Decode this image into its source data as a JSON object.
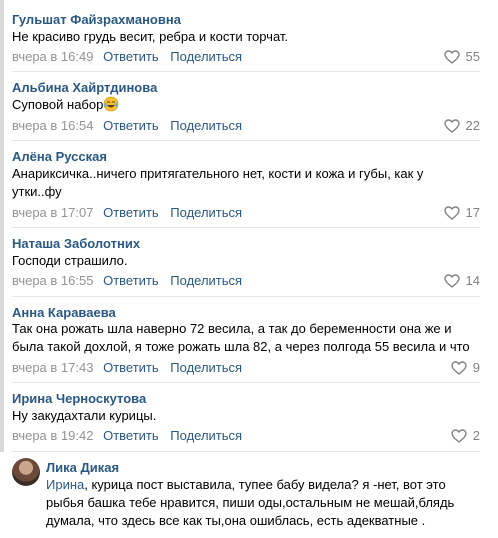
{
  "comments": [
    {
      "author": "Гульшат Файзрахмановна",
      "text": "Не красиво грудь весит, ребра и кости торчат.",
      "time": "вчера в 16:49",
      "reply": "Ответить",
      "share": "Поделиться",
      "likes": "55"
    },
    {
      "author": "Альбина Хайртдинова",
      "text": "Суповой набор",
      "emoji": "laughing-tears-icon",
      "time": "вчера в 16:54",
      "reply": "Ответить",
      "share": "Поделиться",
      "likes": "22"
    },
    {
      "author": "Алёна Русская",
      "text": "Анариксичка..ничего притягательного нет, кости и кожа и губы, как у утки..фу",
      "time": "вчера в 17:07",
      "reply": "Ответить",
      "share": "Поделиться",
      "likes": "17"
    },
    {
      "author": "Наташа Заболотних",
      "text": "Господи страшило.",
      "time": "вчера в 16:55",
      "reply": "Ответить",
      "share": "Поделиться",
      "likes": "14"
    },
    {
      "author": "Анна Караваева",
      "text": "Так она рожать шла наверно 72 весила, а так до беременности она же и была такой дохлой, я тоже рожать шла 82, а через полгода 55 весила и что",
      "time": "вчера в 17:43",
      "reply": "Ответить",
      "share": "Поделиться",
      "likes": "9"
    },
    {
      "author": "Ирина Черноскутова",
      "text": "Ну закудахтали курицы.",
      "time": "вчера в 19:42",
      "reply": "Ответить",
      "share": "Поделиться",
      "likes": "2"
    },
    {
      "author": "Лика Дикая",
      "reply_to": "Ирина",
      "text": ", курица пост выставила, тупее бабу видела? я -нет, вот это рыбья башка тебе нравится, пиши оды,остальным не мешай,блядь думала, что здесь все как ты,она ошиблась, есть адекватные ."
    }
  ],
  "colors": {
    "link": "#2a5885",
    "meta": "#939393",
    "divider": "#e7e8ec"
  }
}
